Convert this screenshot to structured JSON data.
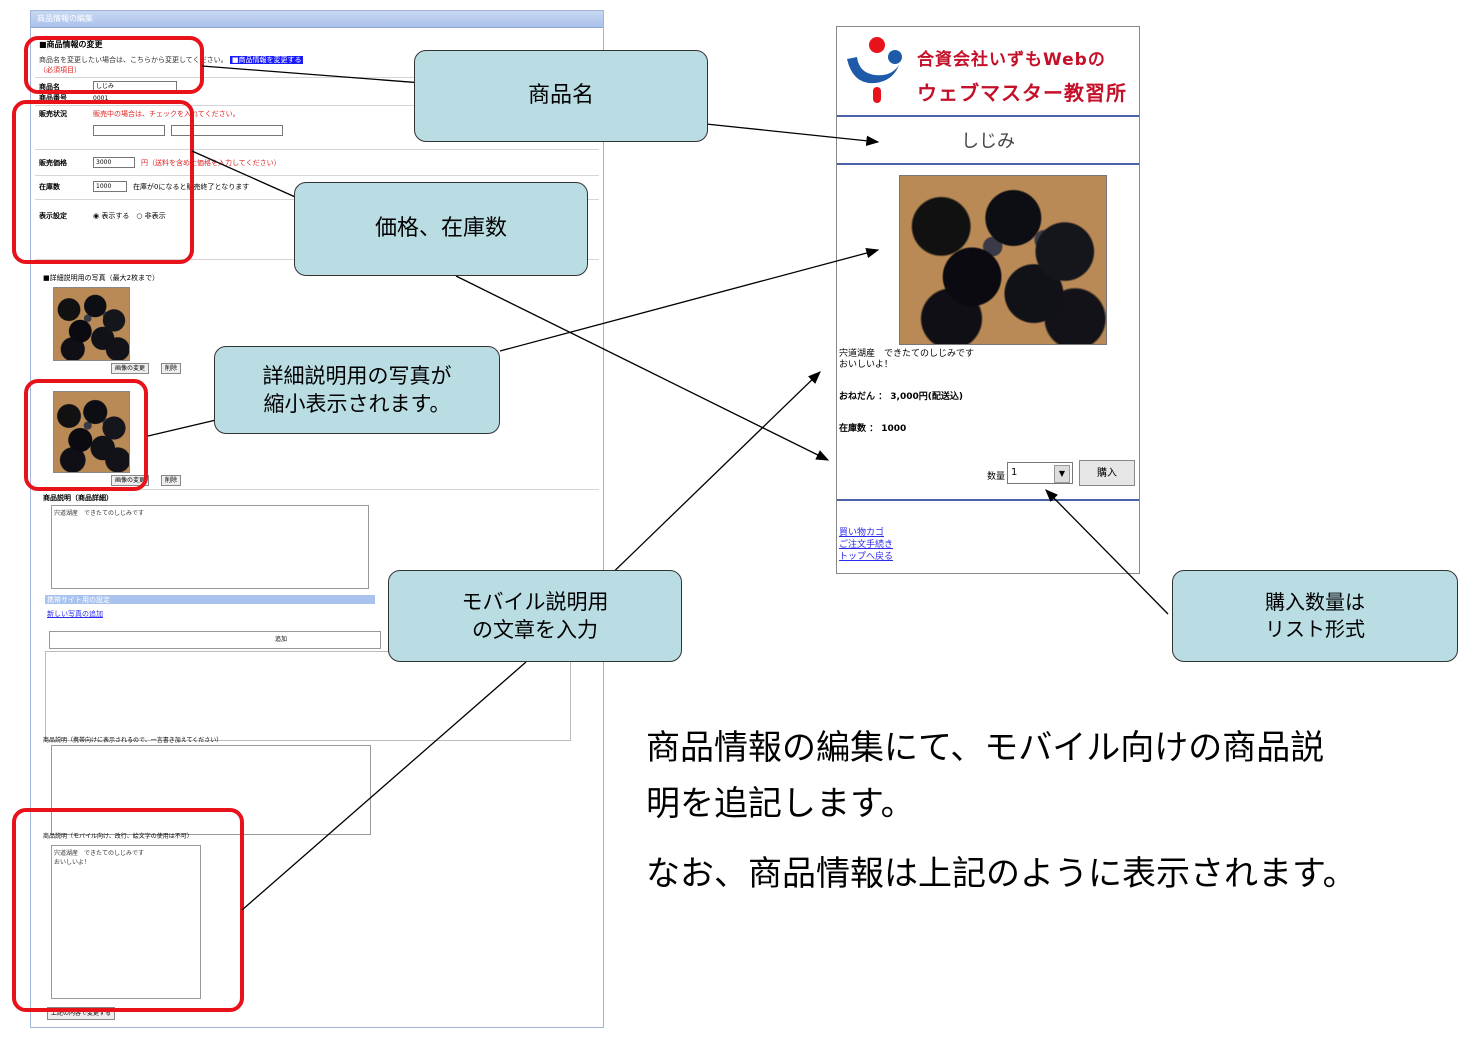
{
  "admin_form": {
    "window_title": "商品情報の編集",
    "section_heading": "■商品情報の変更",
    "guide_text": "商品名を変更したい場合は、こちらから変更してください。",
    "guide_link": "■商品情報を変更する",
    "guide_note": "（必須項目）",
    "field_name_label": "商品名",
    "field_name_value": "しじみ",
    "field_code_label": "商品番号",
    "field_code_value": "0001",
    "field_status_label": "販売状況",
    "field_status_note": "販売中の場合は、チェックを入れてください。",
    "field_price_label": "販売価格",
    "field_price_value": "3000",
    "field_price_note": "円（送料を含めた価格を入力してください）",
    "field_stock_label": "在庫数",
    "field_stock_value": "1000",
    "field_stock_note": "在庫が0になると販売終了となります",
    "field_display_label": "表示設定",
    "image_section_note": "■詳細説明用の写真（最大2枚まで）",
    "image_btn_change": "画像の変更",
    "image_btn_delete": "削除",
    "detail_label": "商品説明（商品詳細）",
    "detail_text": "宍道湖産　できたてのしじみです",
    "mobile_section_title": "携帯サイト用の設定",
    "mobile_link": "新しい写真の追加",
    "mobile_add_btn": "追加",
    "mobile_desc_label": "商品説明（携帯向けに表示されるので、一言書き加えてください）",
    "mobile_desc2_label": "商品説明（モバイル向け、改行、絵文字の使用は不可）",
    "mobile_desc2_text": "宍道湖産　できたてのしじみです\nおいしいよ！",
    "submit_btn": "上記の内容で変更する"
  },
  "mobile_page": {
    "logo_line1": "合資会社いずもWebの",
    "logo_line2": "ウェブマスター教習所",
    "product_name": "しじみ",
    "description_line1": "宍道湖産　できたてのしじみです",
    "description_line2": "おいしいよ！",
    "price": "おねだん ： 3,000円(配送込)",
    "stock": "在庫数 ： 1000",
    "qty_label": "数量",
    "qty_value": "1",
    "buy_button": "購入",
    "links": [
      "買い物カゴ",
      "ご注文手続き",
      "トップへ戻る"
    ]
  },
  "callouts": {
    "product_name": "商品名",
    "price_stock": "価格、在庫数",
    "photo_line1": "詳細説明用の写真が",
    "photo_line2": "縮小表示されます。",
    "mobile_text_line1": "モバイル説明用",
    "mobile_text_line2": "の文章を入力",
    "qty_line1": "購入数量は",
    "qty_line2": "リスト形式"
  },
  "description": {
    "line1": "商品情報の編集にて、モバイル向けの商品説",
    "line2": "明を追記します。",
    "line3": "なお、商品情報は上記のように表示されます。"
  },
  "colors": {
    "callout_fill": "#b9dde3",
    "highlight_red": "#e8121b",
    "logo_red": "#c5102a",
    "link_blue": "#2a2aee"
  }
}
